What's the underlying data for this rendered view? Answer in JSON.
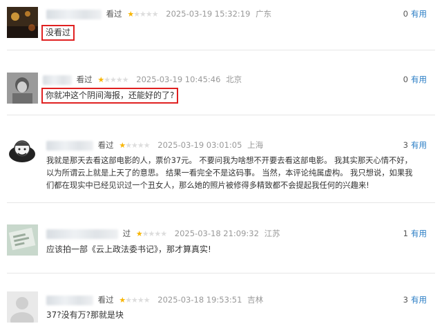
{
  "comments": [
    {
      "watched": "看过",
      "stars": 1,
      "time": "2025-03-19 15:32:19",
      "location": "广东",
      "useful_count": "0",
      "useful_label": "有用",
      "text": "没看过",
      "highlighted": true
    },
    {
      "watched": "看过",
      "stars": 1,
      "time": "2025-03-19 10:45:46",
      "location": "北京",
      "useful_count": "0",
      "useful_label": "有用",
      "text": "你就冲这个阴间海报，还能好的了?",
      "highlighted": true
    },
    {
      "watched": "看过",
      "stars": 1,
      "time": "2025-03-19 03:01:05",
      "location": "上海",
      "useful_count": "3",
      "useful_label": "有用",
      "text_lines": [
        "我就是那天去看这部电影的人，票价37元。 不要问我为啥想不开要去看这部电影。 我其实那天心情不好，",
        "以为所谓云上就是上天了的意思。 结果一看完全不是这码事。 当然，本评论纯属虚构。 我只想说，如果我",
        "们都在现实中已经见识过一个丑女人，那么她的照片被修得多精致都不会提起我任何的兴趣来!"
      ],
      "highlighted": false
    },
    {
      "watched": "过",
      "stars": 1,
      "time": "2025-03-18 21:09:32",
      "location": "江苏",
      "useful_count": "1",
      "useful_label": "有用",
      "text": "应该拍一部《云上政法委书记》，那才算真实!",
      "highlighted": false
    },
    {
      "watched": "看过",
      "stars": 1,
      "time": "2025-03-18 19:53:51",
      "location": "吉林",
      "useful_count": "3",
      "useful_label": "有用",
      "text": "37?没有万?那就是块",
      "highlighted": false
    }
  ],
  "colors": {
    "star_on": "#f8b500",
    "link": "#2a7dc5",
    "highlight_border": "#e02020"
  }
}
